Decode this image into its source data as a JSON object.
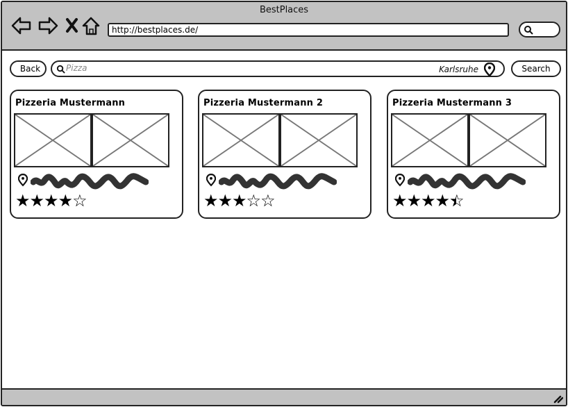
{
  "window": {
    "title": "BestPlaces"
  },
  "browser": {
    "url": "http://bestplaces.de/"
  },
  "toolbar": {
    "back_label": "Back",
    "search_label": "Search"
  },
  "search": {
    "query": "Pizza",
    "location": "Karlsruhe"
  },
  "results": [
    {
      "name": "Pizzeria Mustermann",
      "rating": 4,
      "rating_max": 5
    },
    {
      "name": "Pizzeria Mustermann 2",
      "rating": 3,
      "rating_max": 5
    },
    {
      "name": "Pizzeria Mustermann 3",
      "rating": 4.5,
      "rating_max": 5
    }
  ],
  "icons": {
    "browser_nav": [
      "arrow-left-icon",
      "arrow-right-icon",
      "close-icon",
      "home-icon"
    ],
    "address_search": "search-icon",
    "search_field": "search-icon",
    "location": "map-pin-icon",
    "card_image": "image-placeholder-icon",
    "rating": "star-icon",
    "resize": "resize-grip-icon"
  }
}
